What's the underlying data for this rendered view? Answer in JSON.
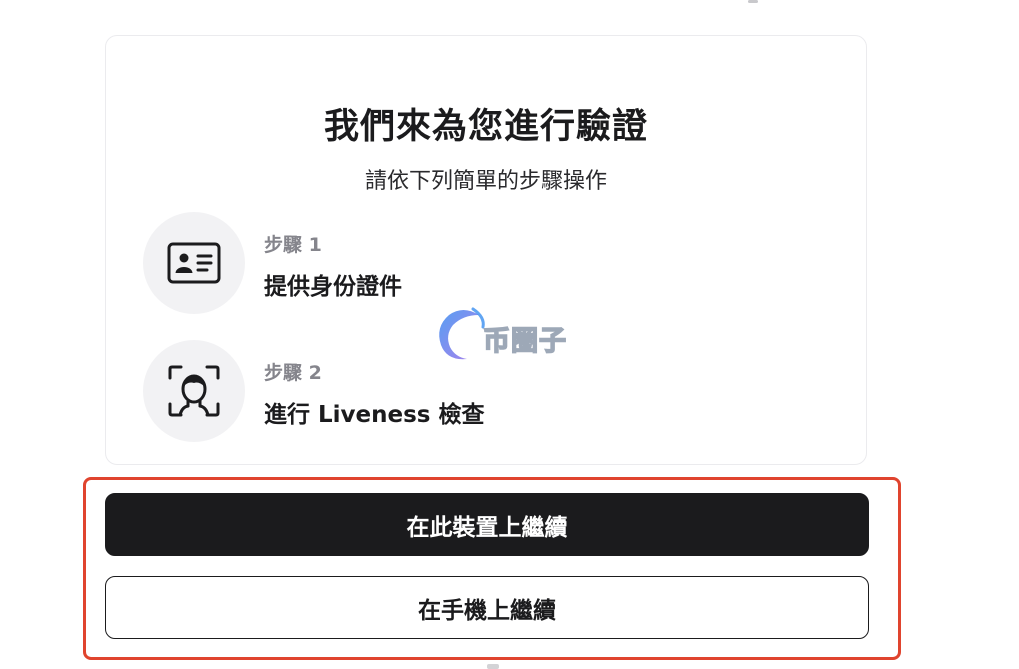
{
  "verification": {
    "title": "我們來為您進行驗證",
    "subtitle": "請依下列簡單的步驟操作",
    "steps": [
      {
        "label": "步驟 1",
        "text": "提供身份證件",
        "icon": "id-card-icon"
      },
      {
        "label": "步驟 2",
        "text": "進行 Liveness 檢查",
        "icon": "face-scan-icon"
      }
    ]
  },
  "watermark": {
    "text": "币圈子"
  },
  "actions": {
    "continue_device_label": "在此裝置上繼續",
    "continue_phone_label": "在手機上繼續"
  },
  "colors": {
    "primary_button": "#1b1b1d",
    "highlight_border": "#e0442e",
    "step_circle": "#f2f2f4",
    "step_label": "#85858c"
  }
}
